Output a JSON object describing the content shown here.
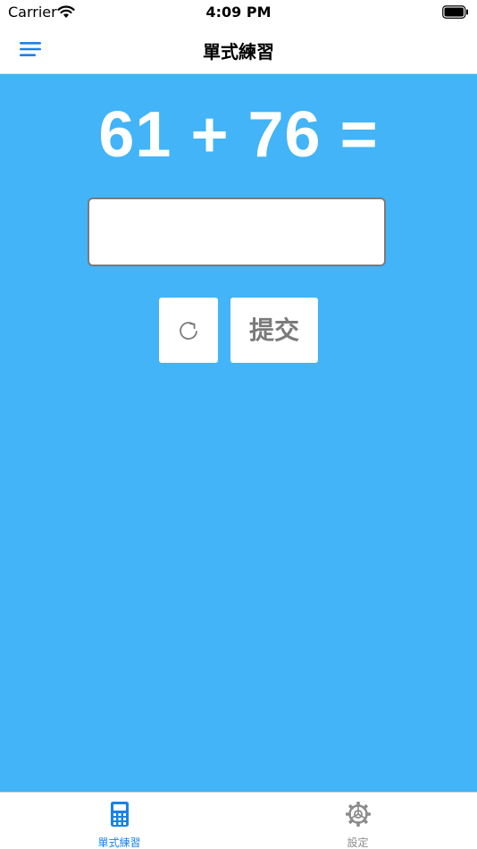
{
  "status_bar": {
    "carrier": "Carrier",
    "time": "4:09 PM",
    "wifi_icon": "wifi-icon",
    "battery_icon": "battery-icon"
  },
  "nav": {
    "title": "單式練習",
    "menu_icon": "hamburger-menu-icon"
  },
  "main": {
    "equation": "61 + 76 =",
    "answer_value": "",
    "refresh_icon": "refresh-icon",
    "submit_label": "提交"
  },
  "tabs": [
    {
      "label": "單式練習",
      "icon": "calculator-icon",
      "active": true
    },
    {
      "label": "設定",
      "icon": "gear-icon",
      "active": false
    }
  ],
  "colors": {
    "background": "#42b4f7",
    "accent": "#1a82e8",
    "inactive": "#8c8c8c",
    "button_text": "#7a7a7a"
  }
}
